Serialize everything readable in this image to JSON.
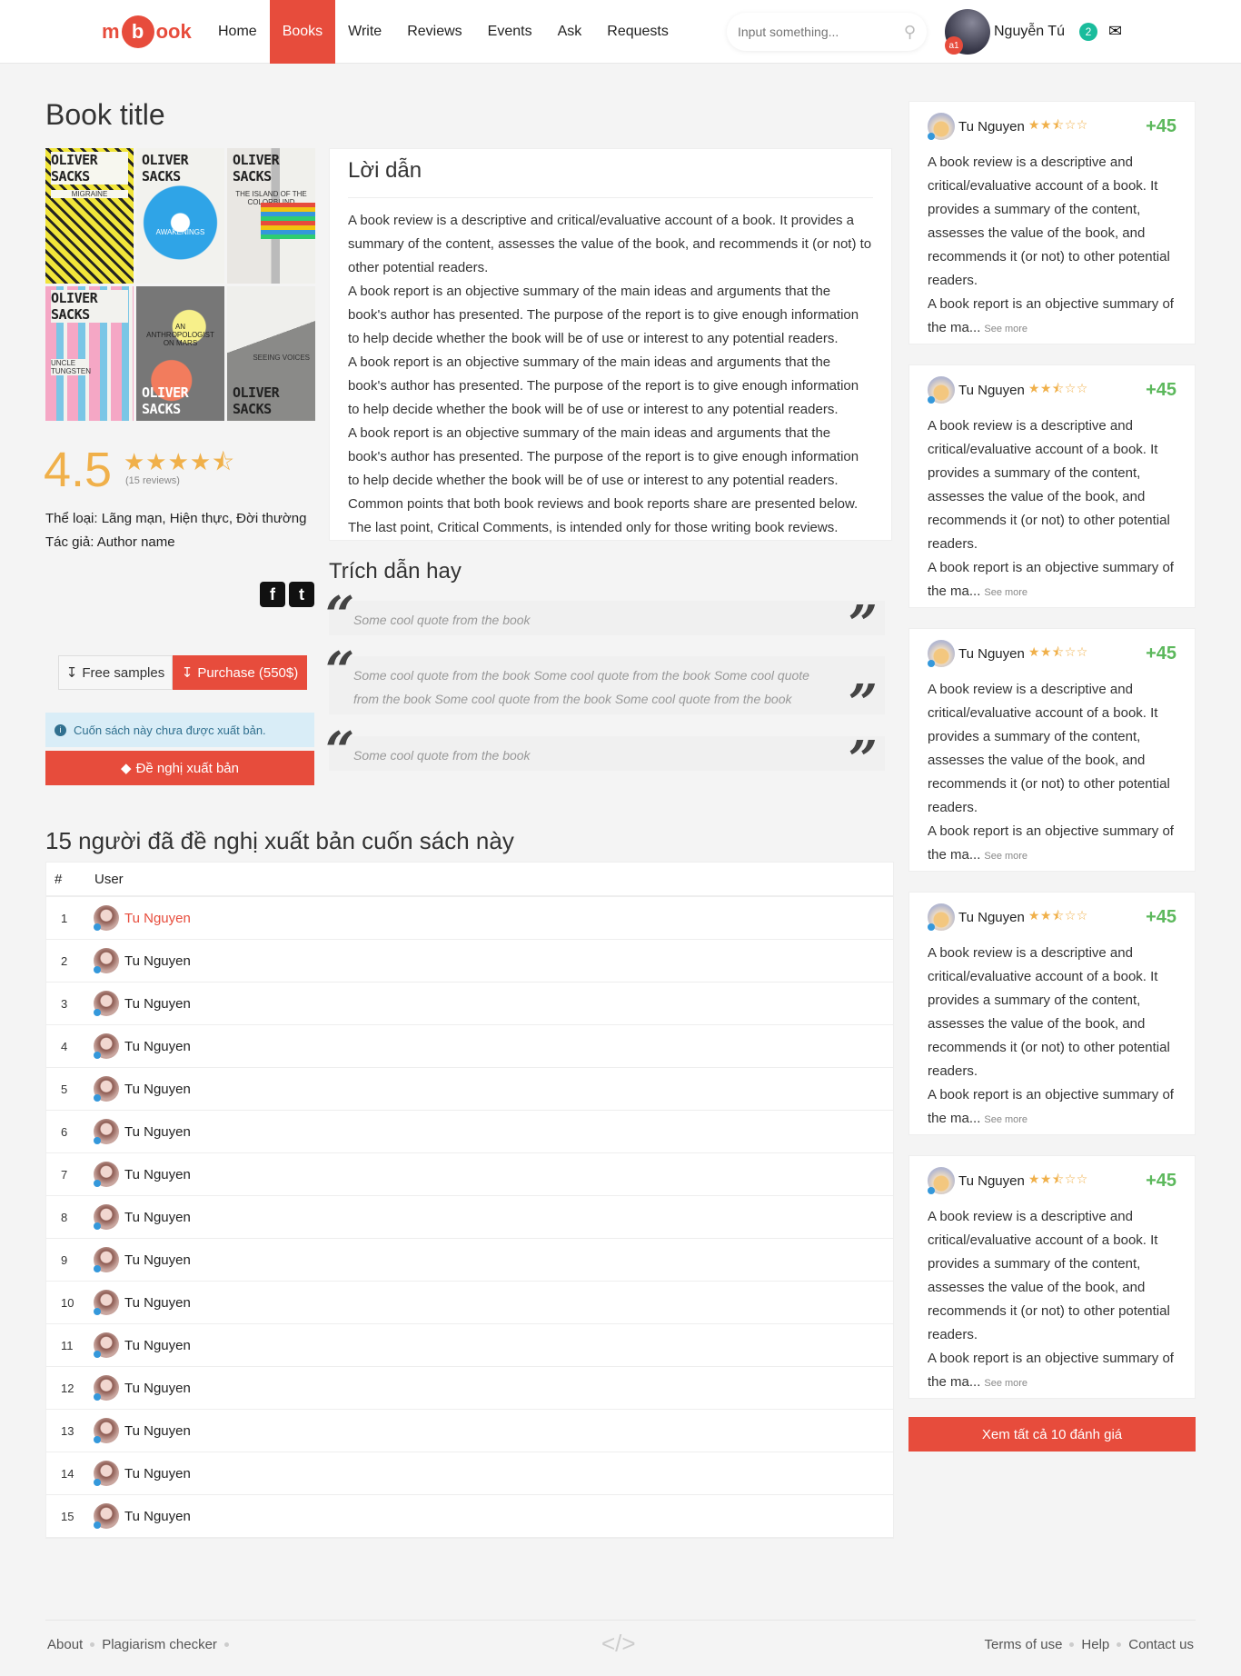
{
  "nav": {
    "logo_left": "m",
    "logo_mid": "b",
    "logo_right": "ook",
    "items": [
      "Home",
      "Books",
      "Write",
      "Reviews",
      "Events",
      "Ask",
      "Requests"
    ],
    "active_index": 1,
    "search_placeholder": "Input something...",
    "search_icon": "search-icon",
    "user_name": "Nguyễn Tú",
    "user_level": "a1",
    "notification_count": "2",
    "inbox_icon": "inbox-icon"
  },
  "book": {
    "title": "Book title",
    "cover_author": "OLIVER SACKS",
    "cover_titles": [
      "MIGRAINE",
      "AWAKENINGS",
      "THE ISLAND OF THE COLORBLIND",
      "UNCLE TUNGSTEN",
      "AN ANTHROPOLOGIST ON MARS",
      "SEEING VOICES"
    ],
    "rating": "4.5",
    "rating_value": 4.5,
    "rating_max": 5,
    "reviews_count": "(15 reviews)",
    "genre_label": "Thể loại:",
    "genre_value": "Lãng mạn, Hiện thực, Đời thường",
    "author_label": "Tác giả:",
    "author_value": "Author name",
    "free_samples": "Free samples",
    "purchase": "Purchase (550$)",
    "not_published_notice": "Cuốn sách này chưa được xuất bản.",
    "suggest_publish": "Đề nghị xuất bản"
  },
  "intro": {
    "title": "Lời dẫn",
    "text": "A book review is a descriptive and critical/evaluative account of a book. It provides a summary of the content, assesses the value of the book, and recommends it (or not) to other potential readers.\nA book report is an objective summary of the main ideas and arguments that the book's author has presented. The purpose of the report is to give enough information to help decide whether the book will be of use or interest to any potential readers.\nA book report is an objective summary of the main ideas and arguments that the book's author has presented. The purpose of the report is to give enough information to help decide whether the book will be of use or interest to any potential readers.\nA book report is an objective summary of the main ideas and arguments that the book's author has presented. The purpose of the report is to give enough information to help decide whether the book will be of use or interest to any potential readers.\nCommon points that both book reviews and book reports share are presented below. The last point, Critical Comments, is intended only for those writing book reviews."
  },
  "quotes": {
    "title": "Trích dẫn hay",
    "items": [
      "Some cool quote from the book",
      "Some cool quote from the book Some cool quote from the book Some cool quote from the book Some cool quote from the book Some cool quote from the book",
      "Some cool quote from the book"
    ]
  },
  "suggesters": {
    "title": "15 người đã đề nghị xuất bản cuốn sách này",
    "col_num": "#",
    "col_user": "User",
    "rows": [
      {
        "n": "1",
        "name": "Tu Nguyen"
      },
      {
        "n": "2",
        "name": "Tu Nguyen"
      },
      {
        "n": "3",
        "name": "Tu Nguyen"
      },
      {
        "n": "4",
        "name": "Tu Nguyen"
      },
      {
        "n": "5",
        "name": "Tu Nguyen"
      },
      {
        "n": "6",
        "name": "Tu Nguyen"
      },
      {
        "n": "7",
        "name": "Tu Nguyen"
      },
      {
        "n": "8",
        "name": "Tu Nguyen"
      },
      {
        "n": "9",
        "name": "Tu Nguyen"
      },
      {
        "n": "10",
        "name": "Tu Nguyen"
      },
      {
        "n": "11",
        "name": "Tu Nguyen"
      },
      {
        "n": "12",
        "name": "Tu Nguyen"
      },
      {
        "n": "13",
        "name": "Tu Nguyen"
      },
      {
        "n": "14",
        "name": "Tu Nguyen"
      },
      {
        "n": "15",
        "name": "Tu Nguyen"
      }
    ]
  },
  "reviews": {
    "items": [
      {
        "name": "Tu Nguyen",
        "stars": 2.5,
        "score": "+45",
        "text": "A book review is a descriptive and critical/evaluative account of a book. It provides a summary of the content, assesses the value of the book, and recommends it (or not) to other potential readers.\nA book report is an objective summary of the ma...",
        "more": "See more"
      },
      {
        "name": "Tu Nguyen",
        "stars": 2.5,
        "score": "+45",
        "text": "A book review is a descriptive and critical/evaluative account of a book. It provides a summary of the content, assesses the value of the book, and recommends it (or not) to other potential readers.\nA book report is an objective summary of the ma...",
        "more": "See more"
      },
      {
        "name": "Tu Nguyen",
        "stars": 2.5,
        "score": "+45",
        "text": "A book review is a descriptive and critical/evaluative account of a book. It provides a summary of the content, assesses the value of the book, and recommends it (or not) to other potential readers.\nA book report is an objective summary of the ma...",
        "more": "See more"
      },
      {
        "name": "Tu Nguyen",
        "stars": 2.5,
        "score": "+45",
        "text": "A book review is a descriptive and critical/evaluative account of a book. It provides a summary of the content, assesses the value of the book, and recommends it (or not) to other potential readers.\nA book report is an objective summary of the ma...",
        "more": "See more"
      },
      {
        "name": "Tu Nguyen",
        "stars": 2.5,
        "score": "+45",
        "text": "A book review is a descriptive and critical/evaluative account of a book. It provides a summary of the content, assesses the value of the book, and recommends it (or not) to other potential readers.\nA book report is an objective summary of the ma...",
        "more": "See more"
      }
    ],
    "see_all": "Xem tất cả 10 đánh giá"
  },
  "footer": {
    "about": "About",
    "plagiarism": "Plagiarism checker",
    "terms": "Terms of use",
    "help": "Help",
    "contact": "Contact us",
    "code_icon": "code-icon"
  },
  "colors": {
    "accent": "#e74c3c",
    "star": "#f0b04a",
    "score": "#5cb85c",
    "notification": "#1abc9c"
  }
}
